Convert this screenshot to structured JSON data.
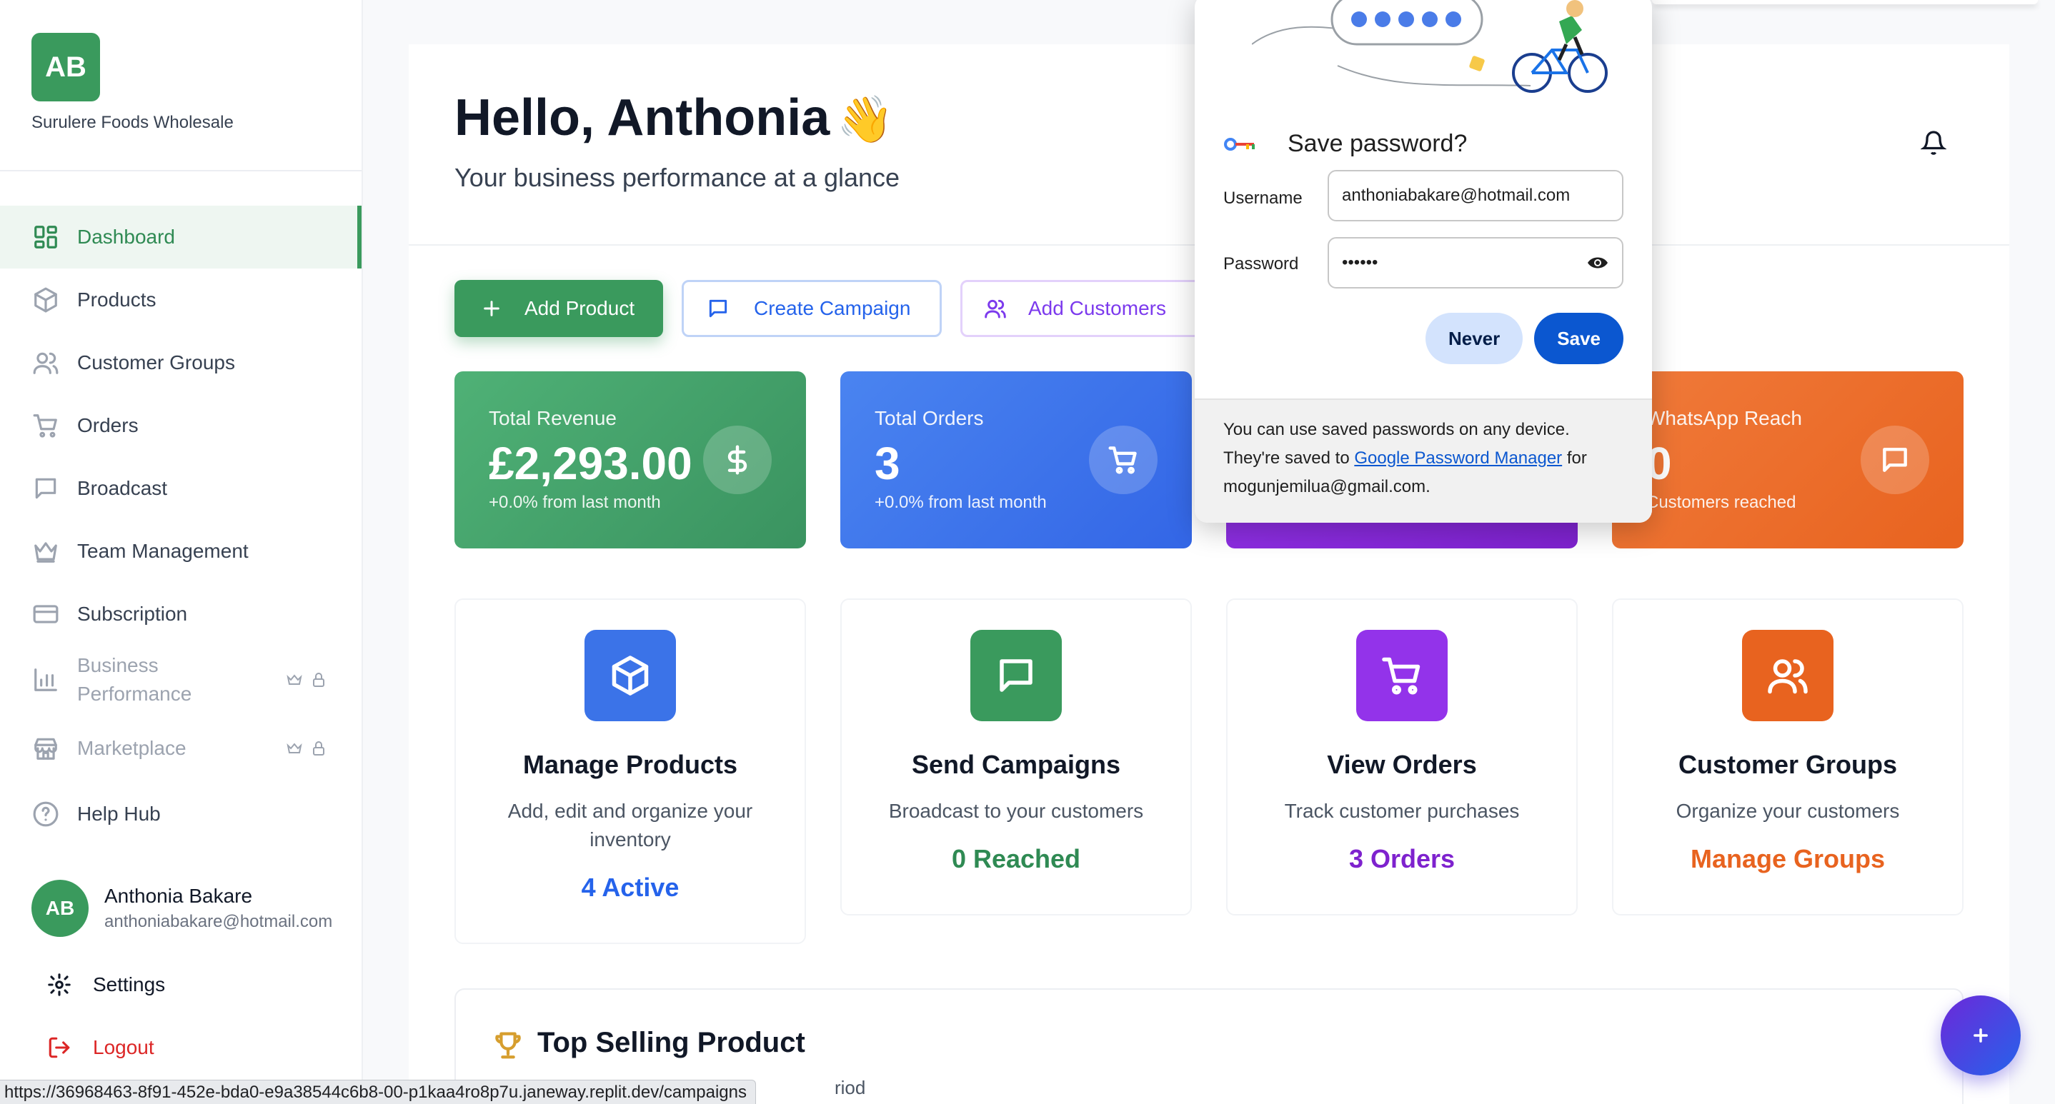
{
  "sidebar": {
    "brand_initials": "AB",
    "brand_name": "Surulere Foods Wholesale",
    "items": [
      {
        "label": "Dashboard",
        "icon": "dashboard-grid-icon",
        "active": true
      },
      {
        "label": "Products",
        "icon": "package-icon"
      },
      {
        "label": "Customer Groups",
        "icon": "users-icon"
      },
      {
        "label": "Orders",
        "icon": "cart-icon"
      },
      {
        "label": "Broadcast",
        "icon": "message-icon"
      },
      {
        "label": "Team Management",
        "icon": "crown-icon"
      },
      {
        "label": "Subscription",
        "icon": "credit-card-icon"
      },
      {
        "label": "Business Performance",
        "icon": "bar-chart-icon",
        "locked": true
      },
      {
        "label": "Marketplace",
        "icon": "store-icon",
        "locked": true
      },
      {
        "label": "Help Hub",
        "icon": "help-circle-icon"
      }
    ],
    "user": {
      "initials": "AB",
      "name": "Anthonia Bakare",
      "email": "anthoniabakare@hotmail.com"
    },
    "settings_label": "Settings",
    "logout_label": "Logout"
  },
  "header": {
    "greeting": "Hello, Anthonia",
    "wave_emoji": "👋",
    "subtitle": "Your business performance at a glance"
  },
  "actions": {
    "add_product": "Add Product",
    "create_campaign": "Create Campaign",
    "add_customers": "Add Customers"
  },
  "stats": [
    {
      "title": "Total Revenue",
      "value": "£2,293.00",
      "caption": "+0.0% from last month",
      "icon": "dollar-icon"
    },
    {
      "title": "Total Orders",
      "value": "3",
      "caption": "+0.0% from last month",
      "icon": "cart-icon"
    },
    {
      "title": "WhatsApp Reach",
      "value": "0",
      "caption": "Customers reached",
      "icon": "message-icon"
    }
  ],
  "features": [
    {
      "title": "Manage Products",
      "desc": "Add, edit and organize your inventory",
      "stat": "4 Active",
      "icon": "package-icon"
    },
    {
      "title": "Send Campaigns",
      "desc": "Broadcast to your customers",
      "stat": "0 Reached",
      "icon": "message-icon"
    },
    {
      "title": "View Orders",
      "desc": "Track customer purchases",
      "stat": "3 Orders",
      "icon": "cart-icon"
    },
    {
      "title": "Customer Groups",
      "desc": "Organize your customers",
      "stat": "Manage Groups",
      "icon": "users-icon"
    }
  ],
  "top_selling": {
    "title": "Top Selling Product",
    "subtitle_visible": "riod"
  },
  "status_url": "https://36968463-8f91-452e-bda0-e9a38544c6b8-00-p1kaa4ro8p7u.janeway.replit.dev/campaigns",
  "password_popup": {
    "title": "Save password?",
    "username_label": "Username",
    "username_value": "anthoniabakare@hotmail.com",
    "password_label": "Password",
    "password_value": "••••••",
    "never_label": "Never",
    "save_label": "Save",
    "footer_line1": "You can use saved passwords on any device.",
    "footer_line2_pre": "They're saved to ",
    "footer_link": "Google Password Manager",
    "footer_line2_post": " for",
    "footer_line3": "mogunjemilua@gmail.com."
  },
  "colors": {
    "brand_green": "#3a9a5d",
    "blue": "#2563eb",
    "purple": "#7e22ce",
    "orange": "#e8631f",
    "google_blue": "#0b57d0"
  }
}
